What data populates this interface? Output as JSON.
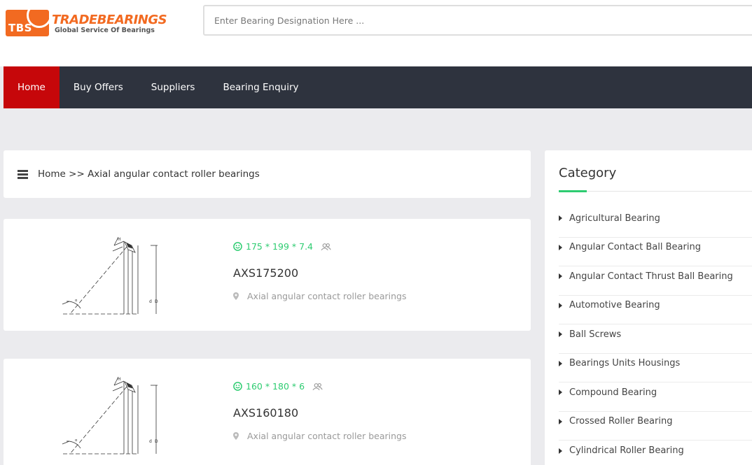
{
  "logo": {
    "badge": "TBS",
    "brand": "TRADEBEARINGS",
    "tagline": "Global Service Of Bearings"
  },
  "search": {
    "placeholder": "Enter Bearing Designation Here ..."
  },
  "nav": {
    "items": [
      {
        "label": "Home",
        "active": true
      },
      {
        "label": "Buy Offers",
        "active": false
      },
      {
        "label": "Suppliers",
        "active": false
      },
      {
        "label": "Bearing Enquiry",
        "active": false
      }
    ]
  },
  "breadcrumb": {
    "text": "Home >> Axial angular contact roller bearings"
  },
  "products": [
    {
      "dimensions": "175 * 199 * 7.4",
      "name": "AXS175200",
      "category": "Axial angular contact roller bearings"
    },
    {
      "dimensions": "160 * 180 * 6",
      "name": "AXS160180",
      "category": "Axial angular contact roller bearings"
    }
  ],
  "sidebar": {
    "title": "Category",
    "items": [
      "Agricultural Bearing",
      "Angular Contact Ball Bearing",
      "Angular Contact Thrust Ball Bearing",
      "Automotive Bearing",
      "Ball Screws",
      "Bearings Units Housings",
      "Compound Bearing",
      "Crossed Roller Bearing",
      "Cylindrical Roller Bearing"
    ]
  },
  "colors": {
    "brand_orange": "#f26a21",
    "nav_bg": "#2e333e",
    "nav_active": "#c6070a",
    "accent_green": "#2ecc71"
  }
}
